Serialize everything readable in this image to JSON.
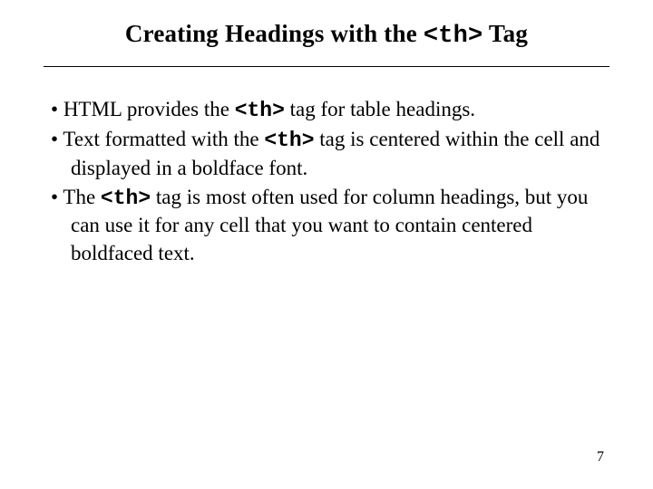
{
  "title": {
    "pre": "Creating Headings with the ",
    "code": "<th>",
    "post": " Tag"
  },
  "bullets": [
    {
      "pre": "HTML provides the ",
      "code": "<th>",
      "post": " tag for table headings."
    },
    {
      "pre": "Text formatted with the ",
      "code": "<th>",
      "post": " tag is centered within the cell and displayed in a boldface font."
    },
    {
      "pre": "The ",
      "code": "<th>",
      "post": " tag is most often used for column headings, but you can use it for any cell that you want to contain centered boldfaced text."
    }
  ],
  "pageNumber": "7"
}
